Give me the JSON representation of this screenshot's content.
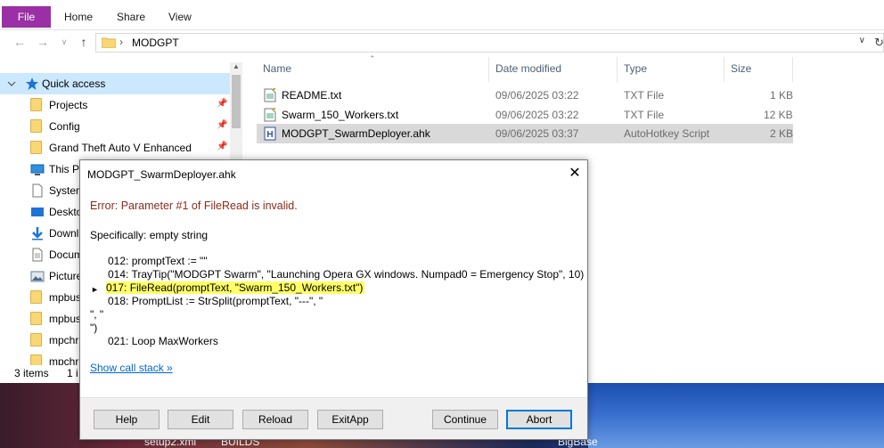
{
  "ribbon": {
    "tabs": [
      "File",
      "Home",
      "Share",
      "View"
    ]
  },
  "address": {
    "path": "MODGPT"
  },
  "navpane": {
    "items": [
      {
        "label": "Quick access",
        "icon": "star-icon",
        "selected": true,
        "pinned": false
      },
      {
        "label": "Projects",
        "icon": "folder-icon",
        "selected": false,
        "pinned": true
      },
      {
        "label": "Config",
        "icon": "folder-icon",
        "selected": false,
        "pinned": true
      },
      {
        "label": "Grand Theft Auto V Enhanced",
        "icon": "folder-icon",
        "selected": false,
        "pinned": true
      },
      {
        "label": "This PC",
        "icon": "computer-icon",
        "selected": false,
        "pinned": false
      },
      {
        "label": "System",
        "icon": "document-icon",
        "selected": false,
        "pinned": false
      },
      {
        "label": "Desktop",
        "icon": "desktop-icon",
        "selected": false,
        "pinned": false
      },
      {
        "label": "Downl",
        "icon": "download-icon",
        "selected": false,
        "pinned": false
      },
      {
        "label": "Docum",
        "icon": "documents-icon",
        "selected": false,
        "pinned": false
      },
      {
        "label": "Picture",
        "icon": "pictures-icon",
        "selected": false,
        "pinned": false
      },
      {
        "label": "mpbus",
        "icon": "folder-icon",
        "selected": false,
        "pinned": false
      },
      {
        "label": "mpbus",
        "icon": "folder-icon",
        "selected": false,
        "pinned": false
      },
      {
        "label": "mpchr",
        "icon": "folder-icon",
        "selected": false,
        "pinned": false
      },
      {
        "label": "mpchr",
        "icon": "folder-icon",
        "selected": false,
        "pinned": false
      }
    ]
  },
  "status": {
    "count": "3 items",
    "extra": "1 i"
  },
  "filelist": {
    "columns": [
      "Name",
      "Date modified",
      "Type",
      "Size"
    ],
    "rows": [
      {
        "name": "README.txt",
        "date": "09/06/2025 03:22",
        "type": "TXT File",
        "size": "1 KB",
        "icon": "text-file-icon",
        "selected": false
      },
      {
        "name": "Swarm_150_Workers.txt",
        "date": "09/06/2025 03:22",
        "type": "TXT File",
        "size": "12 KB",
        "icon": "text-file-icon",
        "selected": false
      },
      {
        "name": "MODGPT_SwarmDeployer.ahk",
        "date": "09/06/2025 03:37",
        "type": "AutoHotkey Script",
        "size": "2 KB",
        "icon": "ahk-file-icon",
        "selected": true
      }
    ]
  },
  "dialog": {
    "title": "MODGPT_SwarmDeployer.ahk",
    "error": "Error: Parameter #1 of FileRead is invalid.",
    "specifically": "Specifically: empty string",
    "code": [
      "012: promptText := \"\"",
      "014: TrayTip(\"MODGPT Swarm\", \"Launching Opera GX windows. Numpad0 = Emergency Stop\", 10)",
      "017: FileRead(promptText, \"Swarm_150_Workers.txt\")",
      "018: PromptList := StrSplit(promptText, \"---\", \"",
      "\", \"",
      "\")",
      "021: Loop MaxWorkers"
    ],
    "call_stack_link": "Show call stack »",
    "buttons": [
      "Help",
      "Edit",
      "Reload",
      "ExitApp",
      "Continue",
      "Abort"
    ]
  },
  "desktop": {
    "labels": [
      "setup2.xml",
      "BUILDS",
      "BigBase"
    ]
  },
  "colors": {
    "file_tab": "#9b30a6",
    "selection": "#cce8ff",
    "error_text": "#8a2b1a",
    "highlight": "#ffff66",
    "link": "#0066cc",
    "default_button_border": "#0078d7"
  }
}
